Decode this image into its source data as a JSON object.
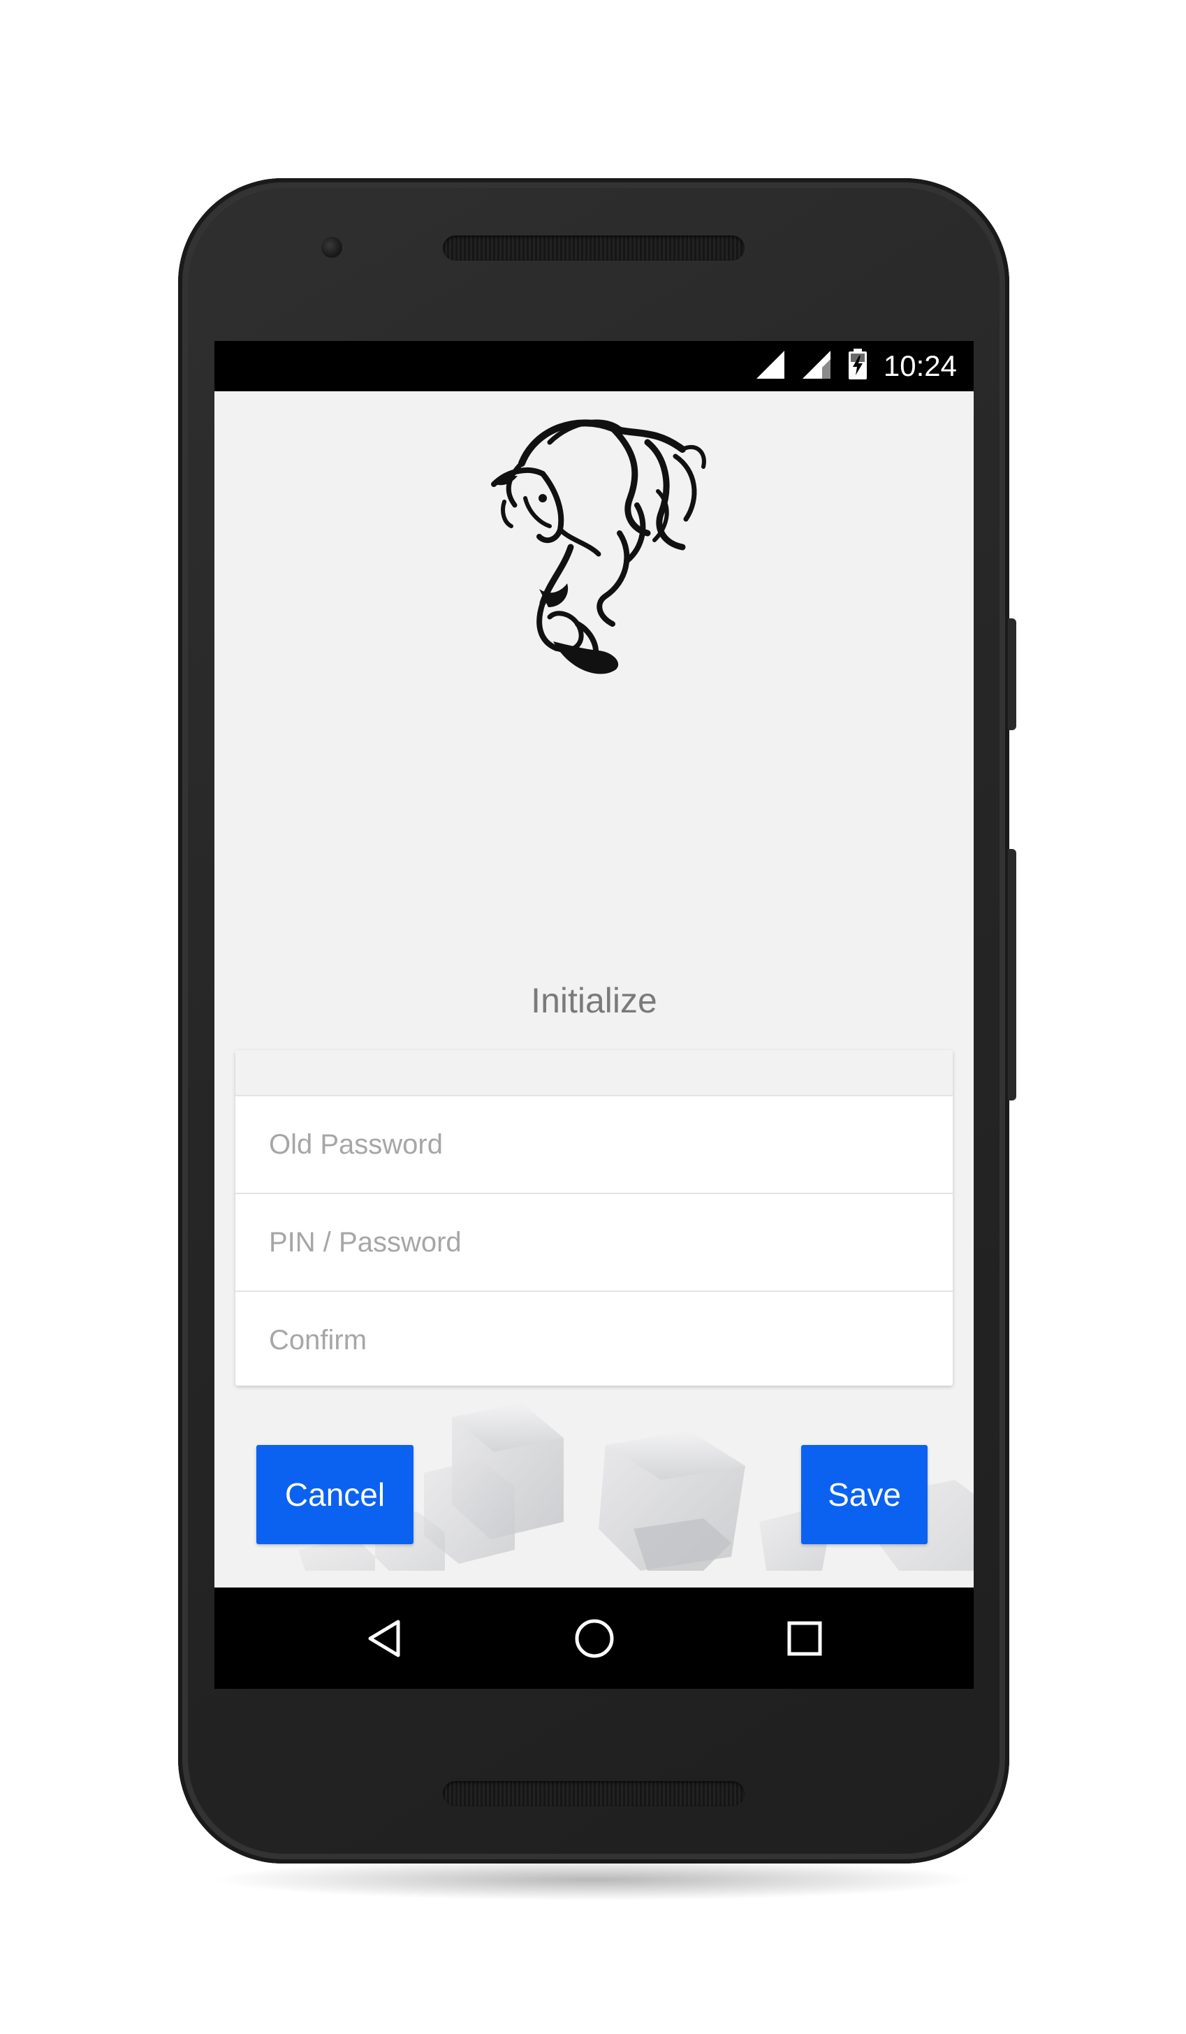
{
  "status_bar": {
    "time": "10:24",
    "icons": [
      "signal-icon",
      "signal-icon",
      "battery-charging-icon"
    ]
  },
  "app": {
    "logo": "horse-logo",
    "title": "Initialize"
  },
  "form": {
    "old_password_placeholder": "Old Password",
    "pin_password_placeholder": "PIN / Password",
    "confirm_placeholder": "Confirm"
  },
  "buttons": {
    "cancel_label": "Cancel",
    "save_label": "Save"
  },
  "nav_bar": {
    "icons": [
      "back-icon",
      "home-icon",
      "recents-icon"
    ]
  },
  "colors": {
    "accent": "#0b62f0",
    "background": "#f2f2f2",
    "title": "#7a7a7a"
  }
}
